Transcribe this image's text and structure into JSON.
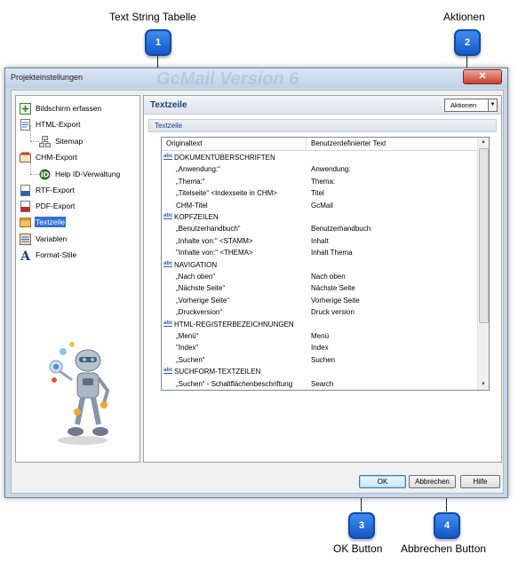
{
  "annotations": [
    {
      "number": "1",
      "label": "Text String Tabelle"
    },
    {
      "number": "2",
      "label": "Aktionen"
    },
    {
      "number": "3",
      "label": "OK Button"
    },
    {
      "number": "4",
      "label": "Abbrechen Button"
    }
  ],
  "window": {
    "title": "Projekteinstellungen",
    "watermark": "GcMail Version 6",
    "close_glyph": "✕"
  },
  "nav": {
    "items": [
      {
        "label": "Bildschirm erfassen",
        "icon": "screen-capture-icon"
      },
      {
        "label": "HTML-Export",
        "icon": "html-export-icon"
      },
      {
        "label": "Sitemap",
        "icon": "sitemap-icon"
      },
      {
        "label": "CHM-Export",
        "icon": "chm-export-icon"
      },
      {
        "label": "Help ID-Verwaltung",
        "icon": "help-id-icon"
      },
      {
        "label": "RTF-Export",
        "icon": "rtf-export-icon"
      },
      {
        "label": "PDF-Export",
        "icon": "pdf-export-icon"
      },
      {
        "label": "Textzeile",
        "icon": "text-line-icon",
        "selected": true
      },
      {
        "label": "Variablen",
        "icon": "variables-icon"
      },
      {
        "label": "Format-Stile",
        "icon": "format-styles-icon"
      }
    ]
  },
  "panel": {
    "title": "Textzeile",
    "aktionen_label": "Aktionen",
    "section_label": "Textzeile"
  },
  "table": {
    "columns": [
      "Originaltext",
      "Benutzerdefinierter Text"
    ],
    "rows": [
      {
        "group": true,
        "original": "DOKUMENTÜBERSCHRIFTEN",
        "custom": ""
      },
      {
        "original": "„Anwendung:“",
        "custom": "Anwendung:"
      },
      {
        "original": "„Thema:“",
        "custom": "Thema:"
      },
      {
        "original": "„Titelseite“ <Indexseite in CHM>",
        "custom": "Titel"
      },
      {
        "original": "CHM-Titel",
        "custom": "GcMail"
      },
      {
        "group": true,
        "original": "KOPFZEILEN",
        "custom": ""
      },
      {
        "original": "„Benutzerhandbuch“",
        "custom": "Benutzerhandbuch"
      },
      {
        "original": "„Inhalte von:“ <STAMM>",
        "custom": "Inhalt"
      },
      {
        "original": "\"Inhalte von:\" <THEMA>",
        "custom": "Inhalt Thema"
      },
      {
        "group": true,
        "original": "NAVIGATION",
        "custom": ""
      },
      {
        "original": "„Nach oben“",
        "custom": "Nach oben"
      },
      {
        "original": "„Nächste Seite“",
        "custom": "Nächste Seite"
      },
      {
        "original": "„Vorherige Seite“",
        "custom": "Vorherige Seite"
      },
      {
        "original": "„Druckversion“",
        "custom": "Druck version"
      },
      {
        "group": true,
        "original": "HTML-REGISTERBEZEICHNUNGEN",
        "custom": ""
      },
      {
        "original": "„Menü“",
        "custom": "Menü"
      },
      {
        "original": "\"Index\"",
        "custom": "Index"
      },
      {
        "original": "„Suchen“",
        "custom": "Suchen"
      },
      {
        "group": true,
        "original": "SUCHFORM-TEXTZEILEN",
        "custom": ""
      },
      {
        "original": "„Suchen“ - Schaltflächenbeschriftung",
        "custom": "Search"
      }
    ],
    "group_icon_text": "abc"
  },
  "buttons": {
    "ok": "OK",
    "cancel": "Abbrechen",
    "help": "Hilfe"
  }
}
